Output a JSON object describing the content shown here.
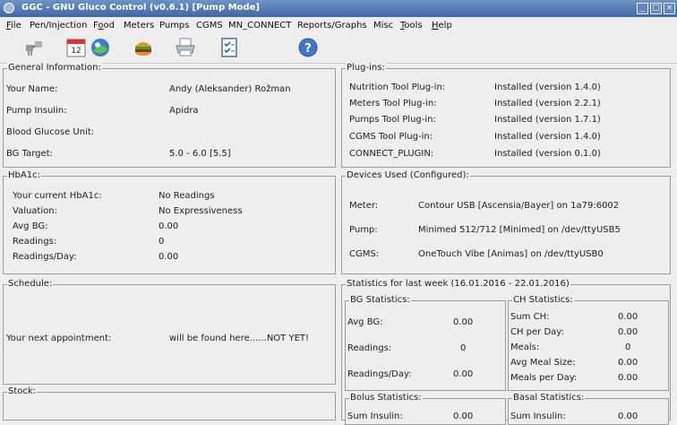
{
  "window": {
    "title": "GGC - GNU Gluco Control (v0.6.1) [Pump Mode]",
    "buttons": {
      "minimize": "_",
      "maximize": "□",
      "close": "×"
    }
  },
  "menu": [
    {
      "label": "File",
      "mnemonic": "F"
    },
    {
      "label": "Pen/Injection",
      "mnemonic": ""
    },
    {
      "label": "Food",
      "mnemonic": "o"
    },
    {
      "label": "Meters",
      "mnemonic": ""
    },
    {
      "label": "Pumps",
      "mnemonic": ""
    },
    {
      "label": "CGMS",
      "mnemonic": ""
    },
    {
      "label": "MN_CONNECT",
      "mnemonic": ""
    },
    {
      "label": "Reports/Graphs",
      "mnemonic": ""
    },
    {
      "label": "Misc",
      "mnemonic": ""
    },
    {
      "label": "Tools",
      "mnemonic": "T"
    },
    {
      "label": "Help",
      "mnemonic": "H"
    }
  ],
  "toolbar": {
    "icons": [
      "connect-icon",
      "calendar-icon",
      "blood-glucose-icon",
      "food-icon",
      "printer-icon",
      "checklist-icon",
      "help-icon"
    ],
    "calendar_day": "12",
    "help_glyph": "?"
  },
  "general": {
    "title": "General Information:",
    "rows": [
      {
        "label": "Your Name:",
        "value": "Andy (Aleksander) Rožman"
      },
      {
        "label": "Pump Insulin:",
        "value": "Apidra"
      },
      {
        "label": "Blood Glucose Unit:",
        "value": ""
      },
      {
        "label": "BG Target:",
        "value": "5.0 - 6.0 [5.5]"
      }
    ]
  },
  "plugins": {
    "title": "Plug-ins:",
    "rows": [
      {
        "label": "Nutrition Tool Plug-in:",
        "value": "Installed (version 1.4.0)"
      },
      {
        "label": "Meters Tool Plug-in:",
        "value": "Installed (version 2.2.1)"
      },
      {
        "label": "Pumps Tool Plug-in:",
        "value": "Installed (version 1.7.1)"
      },
      {
        "label": "CGMS Tool Plug-in:",
        "value": "Installed (version 1.4.0)"
      },
      {
        "label": "CONNECT_PLUGIN:",
        "value": "Installed (version 0.1.0)"
      }
    ]
  },
  "hba1c": {
    "title": "HbA1c:",
    "rows": [
      {
        "label": "Your current HbA1c:",
        "value": "No Readings"
      },
      {
        "label": "Valuation:",
        "value": "No Expressiveness"
      },
      {
        "label": "Avg BG:",
        "value": "0.00"
      },
      {
        "label": "Readings:",
        "value": "0"
      },
      {
        "label": "Readings/Day:",
        "value": "0.00"
      }
    ]
  },
  "devices": {
    "title": "Devices Used (Configured):",
    "rows": [
      {
        "label": "Meter:",
        "value": "Contour USB [Ascensia/Bayer] on 1a79:6002"
      },
      {
        "label": "Pump:",
        "value": "Minimed 512/712 [Minimed] on /dev/ttyUSB5"
      },
      {
        "label": "CGMS:",
        "value": "OneTouch Vibe [Animas] on /dev/ttyUSB0"
      }
    ]
  },
  "schedule": {
    "title": "Schedule:",
    "label": "Your next appointment:",
    "value": "will be found here......NOT YET!"
  },
  "stock": {
    "title": "Stock:"
  },
  "statistics": {
    "title": "Statistics for last week (16.01.2016 - 22.01.2016)",
    "bg": {
      "title": "BG Statistics:",
      "rows": [
        {
          "label": "Avg BG:",
          "value": "0.00"
        },
        {
          "label": "Readings:",
          "value": "0"
        },
        {
          "label": "Readings/Day:",
          "value": "0.00"
        }
      ]
    },
    "ch": {
      "title": "CH Statistics:",
      "rows": [
        {
          "label": "Sum CH:",
          "value": "0.00"
        },
        {
          "label": "CH per Day:",
          "value": "0.00"
        },
        {
          "label": "Meals:",
          "value": "0"
        },
        {
          "label": "Avg Meal Size:",
          "value": "0.00"
        },
        {
          "label": "Meals per Day:",
          "value": "0.00"
        }
      ]
    },
    "bolus": {
      "title": "Bolus Statistics:",
      "first_label": "Sum Insulin:",
      "first_value": "0.00"
    },
    "basal": {
      "title": "Basal Statistics:",
      "first_label": "Sum Insulin:",
      "first_value": "0.00"
    }
  }
}
